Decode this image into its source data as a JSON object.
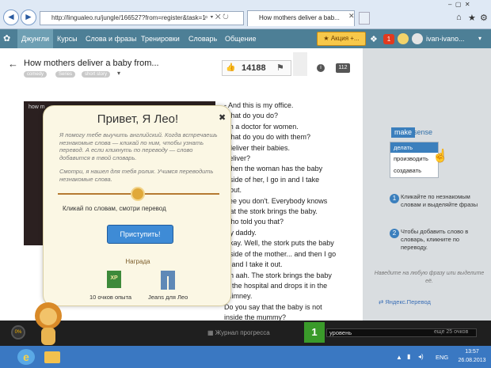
{
  "browser": {
    "url": "http://lingualeo.ru/jungle/166527?from=register&task=1",
    "tab_title": "How mothers deliver a bab..."
  },
  "nav": {
    "items": [
      "Джунгли",
      "Курсы",
      "Слова и фразы",
      "Тренировки",
      "Словарь",
      "Общение"
    ],
    "promo": "Акция +...",
    "notif_count": "1",
    "username": "ivan-ivano..."
  },
  "content": {
    "title": "How mothers deliver a baby from...",
    "tags": [
      "comedy",
      "Series",
      "short story"
    ],
    "likes": "14188",
    "pages": "112",
    "video_label": "how m",
    "transcript": [
      "- And this is my office.",
      "What do you do?",
      "I'm a doctor for women.",
      "What do you do with them?",
      "I deliver their babies.",
      "Deliver?",
      "When the woman has the baby",
      "inside of her, I go in and I take",
      "it out.",
      "See you don't. Everybody knows",
      "that the stork brings the baby.",
      "Who told you that?",
      "My daddy.",
      "Okay. Well, the stork puts the baby",
      "inside of the mother... and then I go",
      "in and I take it out.",
      "Oh aah. The stork brings the baby",
      "to the hospital and drops it in the",
      "chimney.",
      "Do you say that the baby is not",
      "inside the mummy?"
    ]
  },
  "modal": {
    "title": "Привет, Я Лео!",
    "para1": "Я помогу тебе выучить английский. Когда встречаешь незнакомые слова — кликай по ним, чтобы узнать перевод. А если кликнуть по переводу — слово добавится в твой словарь.",
    "para2": "Смотри, я нашел для тебя ролик. Учимся переводить незнакомые слова.",
    "instruction": "Кликай по словам, смотри перевод",
    "button": "Приступить!",
    "reward_title": "Награда",
    "reward1": "10 очков опыта",
    "reward2": "Jeans для Лео",
    "xp_badge": "XP"
  },
  "sidebar": {
    "brand1": "make",
    "brand2": "sense",
    "menu": [
      "делать",
      "производить",
      "создавать"
    ],
    "step1_num": "1",
    "step1": "Кликайте по незнакомым словам и выделяйте фразы",
    "step2_num": "2",
    "step2": "Чтобы добавить слово в словарь, кликните по переводу.",
    "hint": "Наведите на любую фразу или выделите её.",
    "translator": "Яндекс.Перевод"
  },
  "bottom": {
    "progress_pct": "0%",
    "journal": "Журнал прогресса",
    "level_num": "1",
    "level_label": "уровень",
    "level_progress": "еще 25 очков"
  },
  "taskbar": {
    "lang": "ENG",
    "time": "13:57",
    "date": "26.08.2013"
  },
  "colors": {
    "nav_bg": "#4d7f96",
    "accent_blue": "#3e8bd6",
    "level_green": "#3a9a2a",
    "modal_bg": "#fbf7e4"
  }
}
